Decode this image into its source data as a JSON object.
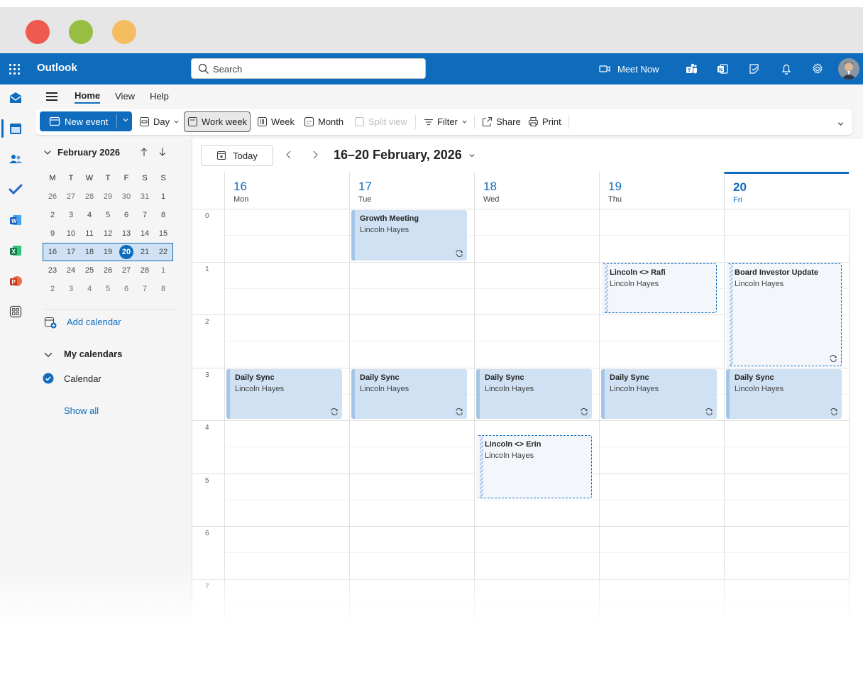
{
  "window": {
    "controls": [
      "close",
      "minimize",
      "maximize"
    ]
  },
  "header": {
    "app_name": "Outlook",
    "search_placeholder": "Search",
    "meet_now_label": "Meet Now",
    "icons": [
      "app-launcher-icon",
      "video-camera-icon",
      "teams-icon",
      "onenote-icon",
      "todo-icon",
      "bell-icon",
      "gear-icon"
    ],
    "accent_color": "#0f6cbd"
  },
  "ribbon": {
    "tabs": [
      {
        "label": "Home",
        "active": true
      },
      {
        "label": "View",
        "active": false
      },
      {
        "label": "Help",
        "active": false
      }
    ],
    "new_event_label": "New event",
    "day_label": "Day",
    "work_week_label": "Work week",
    "week_label": "Week",
    "month_label": "Month",
    "split_view_label": "Split view",
    "filter_label": "Filter",
    "share_label": "Share",
    "print_label": "Print",
    "selected_view": "Work week"
  },
  "mini_calendar": {
    "title": "February 2026",
    "days_of_week": [
      "M",
      "T",
      "W",
      "T",
      "F",
      "S",
      "S"
    ],
    "weeks": [
      [
        "26",
        "27",
        "28",
        "29",
        "30",
        "31",
        "1"
      ],
      [
        "2",
        "3",
        "4",
        "5",
        "6",
        "7",
        "8"
      ],
      [
        "9",
        "10",
        "11",
        "12",
        "13",
        "14",
        "15"
      ],
      [
        "16",
        "17",
        "18",
        "19",
        "20",
        "21",
        "22"
      ],
      [
        "23",
        "24",
        "25",
        "26",
        "27",
        "28",
        "1"
      ],
      [
        "2",
        "3",
        "4",
        "5",
        "6",
        "7",
        "8"
      ]
    ],
    "selected_week_index": 3,
    "today": "20"
  },
  "sidebar": {
    "add_calendar_label": "Add calendar",
    "my_calendars_label": "My calendars",
    "calendar_item_label": "Calendar",
    "calendar_checked": true,
    "show_all_label": "Show all"
  },
  "main": {
    "today_label": "Today",
    "range_title": "16–20 February, 2026",
    "days": [
      {
        "num": "16",
        "name": "Mon",
        "today": false
      },
      {
        "num": "17",
        "name": "Tue",
        "today": false
      },
      {
        "num": "18",
        "name": "Wed",
        "today": false
      },
      {
        "num": "19",
        "name": "Thu",
        "today": false
      },
      {
        "num": "20",
        "name": "Fri",
        "today": true
      }
    ],
    "hours": [
      "0",
      "1",
      "2",
      "3",
      "4",
      "5",
      "6",
      "7"
    ],
    "events": [
      {
        "title": "Growth Meeting",
        "organizer": "Lincoln Hayes",
        "day": 1,
        "start": 0.0,
        "end": 1.0,
        "style": "busy",
        "recurring": true
      },
      {
        "title": "Lincoln <> Rafi",
        "organizer": "Lincoln Hayes",
        "day": 3,
        "start": 1.0,
        "end": 2.0,
        "style": "tentative",
        "recurring": false
      },
      {
        "title": "Board Investor Update",
        "organizer": "Lincoln Hayes",
        "day": 4,
        "start": 1.0,
        "end": 3.0,
        "style": "tentative",
        "recurring": true
      },
      {
        "title": "Daily Sync",
        "organizer": "Lincoln Hayes",
        "day": 0,
        "start": 3.0,
        "end": 4.0,
        "style": "busy",
        "recurring": true
      },
      {
        "title": "Daily Sync",
        "organizer": "Lincoln Hayes",
        "day": 1,
        "start": 3.0,
        "end": 4.0,
        "style": "busy",
        "recurring": true
      },
      {
        "title": "Daily Sync",
        "organizer": "Lincoln Hayes",
        "day": 2,
        "start": 3.0,
        "end": 4.0,
        "style": "busy",
        "recurring": true
      },
      {
        "title": "Daily Sync",
        "organizer": "Lincoln Hayes",
        "day": 3,
        "start": 3.0,
        "end": 4.0,
        "style": "busy",
        "recurring": true
      },
      {
        "title": "Daily Sync",
        "organizer": "Lincoln Hayes",
        "day": 4,
        "start": 3.0,
        "end": 4.0,
        "style": "busy",
        "recurring": true
      },
      {
        "title": "Lincoln <> Erin",
        "organizer": "Lincoln Hayes",
        "day": 2,
        "start": 4.25,
        "end": 5.5,
        "style": "tentative",
        "recurring": false
      }
    ]
  }
}
